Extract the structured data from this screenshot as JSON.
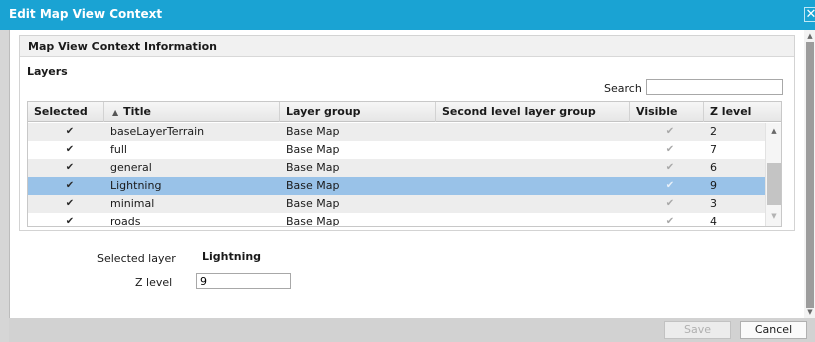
{
  "window": {
    "title": "Edit Map View Context",
    "close_label": "✕"
  },
  "panel": {
    "title": "Map View Context Information"
  },
  "layers": {
    "label": "Layers",
    "search_label": "Search",
    "search_value": ""
  },
  "grid": {
    "columns": [
      "Selected",
      "Title",
      "Layer group",
      "Second level layer group",
      "Visible",
      "Z level"
    ],
    "sort_icon": "▲",
    "rows": [
      {
        "selected": true,
        "title": "baseLayerTerrain",
        "layer_group": "Base Map",
        "second_group": "",
        "visible": true,
        "z_level": "2",
        "highlighted": false
      },
      {
        "selected": true,
        "title": "full",
        "layer_group": "Base Map",
        "second_group": "",
        "visible": true,
        "z_level": "7",
        "highlighted": false
      },
      {
        "selected": true,
        "title": "general",
        "layer_group": "Base Map",
        "second_group": "",
        "visible": true,
        "z_level": "6",
        "highlighted": false
      },
      {
        "selected": true,
        "title": "Lightning",
        "layer_group": "Base Map",
        "second_group": "",
        "visible": true,
        "z_level": "9",
        "highlighted": true
      },
      {
        "selected": true,
        "title": "minimal",
        "layer_group": "Base Map",
        "second_group": "",
        "visible": true,
        "z_level": "3",
        "highlighted": false
      },
      {
        "selected": true,
        "title": "roads",
        "layer_group": "Base Map",
        "second_group": "",
        "visible": true,
        "z_level": "4",
        "highlighted": false
      }
    ]
  },
  "details": {
    "selected_layer_label": "Selected layer",
    "selected_layer_value": "Lightning",
    "z_level_label": "Z level",
    "z_level_value": "9"
  },
  "buttons": {
    "save": "Save",
    "cancel": "Cancel"
  },
  "icons": {
    "checkmark": "✔",
    "scroll_up": "▲",
    "scroll_down": "▼"
  },
  "colors": {
    "titlebar": "#1aa3d3",
    "selected_row": "#99c2e8"
  }
}
